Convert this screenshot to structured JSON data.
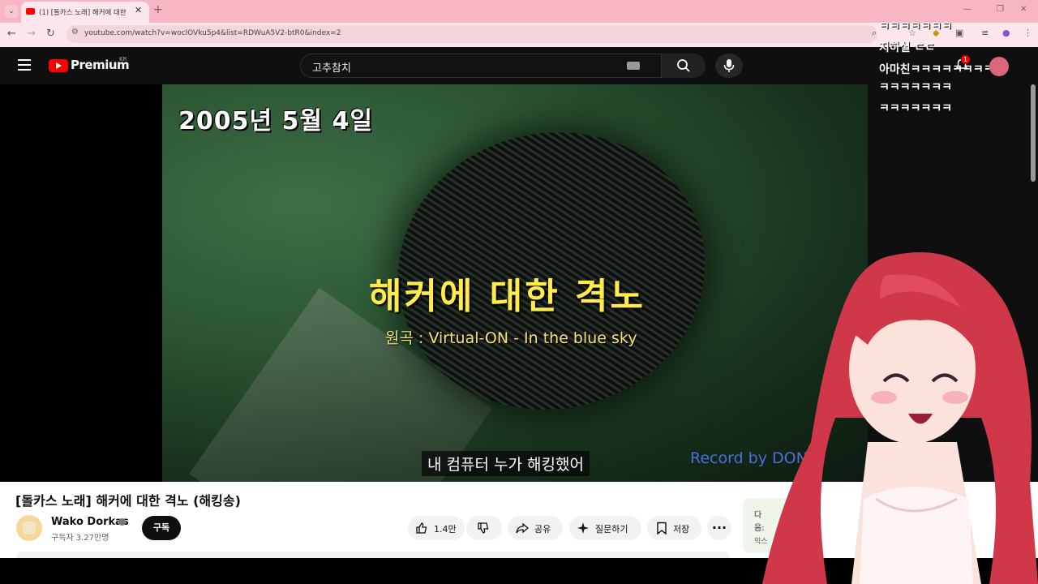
{
  "browser": {
    "tab_title": "(1) [돌카스 노래] 해커에 대한",
    "url": "youtube.com/watch?v=woclOVku5p4&list=RDWuA5V2-btR0&index=2"
  },
  "header": {
    "logo_text": "Premium",
    "region": "KR",
    "search_value": "고추참치"
  },
  "video": {
    "date_overlay": "2005년 5월 4일",
    "title_overlay": "해커에 대한 격노",
    "original_song": "원곡 : Virtual-ON - In the blue sky",
    "caption": "내 컴퓨터 누가 해킹했어",
    "record_by": "Record by DON"
  },
  "chat": [
    "ㅋㅋㅋㅋㅋㅋㅋ",
    "지하실 ㄷㄷ",
    "아마친ㅋㅋㅋㅋㅋㅋㅋㅋ",
    "ㅋㅋㅋㅋㅋㅋㅋ",
    "ㅋㅋㅋㅋㅋㅋㅋ"
  ],
  "notification_count": "1",
  "details": {
    "video_title": "[돌카스 노래] 해커에 대한 격노 (해킹송)",
    "channel_name": "Wako Dorkas",
    "subscribers": "구독자 3.27만명",
    "subscribe_label": "구독",
    "like_count": "1.4만",
    "share_label": "공유",
    "ask_label": "질문하기",
    "save_label": "저장"
  },
  "next_panel": {
    "line1": "다",
    "line2": "음:",
    "line3": "믹스"
  },
  "colors": {
    "youtube_red": "#ff0000",
    "title_yellow": "#ffeb4a",
    "record_blue": "#4a6fd8",
    "tabbar_pink": "#f7b6c2"
  }
}
